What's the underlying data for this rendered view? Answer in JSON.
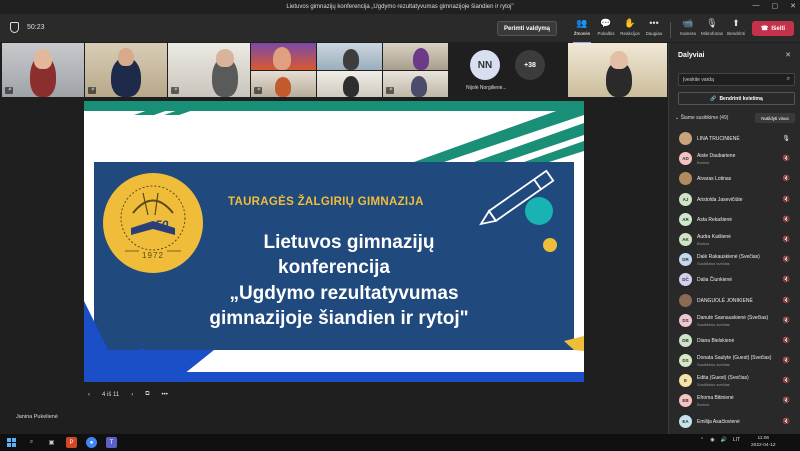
{
  "window": {
    "title": "Lietuvos gimnazijų konferencija „Ugdymo rezultatyvumas gimnazijoje šiandien ir rytoj\""
  },
  "toolbar": {
    "timer": "50:23",
    "take_control": "Perimti valdymą",
    "buttons": [
      {
        "label": "Žmonės",
        "icon": "people-icon"
      },
      {
        "label": "Pokalbis",
        "icon": "chat-icon"
      },
      {
        "label": "Reakcijos",
        "icon": "reactions-icon"
      },
      {
        "label": "Daugiau",
        "icon": "more-icon"
      },
      {
        "label": "Kamera",
        "icon": "camera-icon"
      },
      {
        "label": "Mikrofonas",
        "icon": "microphone-icon"
      },
      {
        "label": "Bendrinti",
        "icon": "share-icon"
      }
    ],
    "leave": "Išeiti"
  },
  "strip": {
    "avatar_initials": "NN",
    "avatar_name": "Nijolė Norgilienė...",
    "more_count": "+38"
  },
  "slide": {
    "school": "TAURAGĖS ŽALGIRIŲ GIMNAZIJA",
    "logo_year": "1972",
    "logo_number": "50",
    "line1": "Lietuvos gimnazijų",
    "line2": "konferencija",
    "line3": "„Ugdymo rezultatyvumas",
    "line4": "gimnazijoje šiandien ir rytoj\""
  },
  "slide_nav": {
    "page": "4 iš 11"
  },
  "presenter": "Janina Pukelienė",
  "panel": {
    "title": "Dalyviai",
    "search_placeholder": "Įveskite vardą",
    "share_invite": "Bendrinti kvietimą",
    "section": "Šiame susitikime (49)",
    "mute_all": "Nutildyti visus",
    "participants": [
      {
        "initials": "",
        "name": "LINA TRUCINIENĖ",
        "sub": "",
        "color": "#c9a37a",
        "photo": true,
        "mic": "on"
      },
      {
        "initials": "AD",
        "name": "Aiste Daubariene",
        "sub": "Borinis",
        "color": "#f4c3c3",
        "mic": "off"
      },
      {
        "initials": "",
        "name": "Aivaras Lotinas",
        "sub": "",
        "color": "#b08c60",
        "photo": true,
        "mic": "off"
      },
      {
        "initials": "AJ",
        "name": "Aristolda Jasevičiūte",
        "sub": "",
        "color": "#cfe3c6",
        "mic": "off"
      },
      {
        "initials": "AR",
        "name": "Asta Rekašienė",
        "sub": "",
        "color": "#cde8cf",
        "mic": "off"
      },
      {
        "initials": "AK",
        "name": "Audra Kaišienė",
        "sub": "Borinis",
        "color": "#cfe3c6",
        "mic": "off"
      },
      {
        "initials": "DR",
        "name": "Dalė Rakauskienė (Svečias)",
        "sub": "Susitikimo svečias",
        "color": "#c4d9ef",
        "mic": "off"
      },
      {
        "initials": "DČ",
        "name": "Dalia Čiunkienė",
        "sub": "",
        "color": "#d6d0f0",
        "mic": "off"
      },
      {
        "initials": "",
        "name": "DANGUOLĖ JONIKIENĖ",
        "sub": "",
        "color": "#8a6a55",
        "photo": true,
        "mic": "off"
      },
      {
        "initials": "DS",
        "name": "Danutė Sasnauskienė (Svečias)",
        "sub": "Susitikimo svečias",
        "color": "#f1c6d3",
        "mic": "off"
      },
      {
        "initials": "DB",
        "name": "Diana Bielskienė",
        "sub": "",
        "color": "#cfe3c6",
        "mic": "off"
      },
      {
        "initials": "DS",
        "name": "Donata Saulyte (Guest) (Svečias)",
        "sub": "Susitikimo svečias",
        "color": "#d7e8c4",
        "mic": "off"
      },
      {
        "initials": "E",
        "name": "Edita (Guest) (Svečias)",
        "sub": "Susitikimo svečias",
        "color": "#f6e3a8",
        "mic": "off"
      },
      {
        "initials": "EB",
        "name": "Efroma Bitinienė",
        "sub": "Borinis",
        "color": "#f4c3c3",
        "mic": "off"
      },
      {
        "initials": "EA",
        "name": "Emilija Asačiovienė",
        "sub": "",
        "color": "#c4e3ea",
        "mic": "off"
      }
    ]
  },
  "taskbar": {
    "tray_lang": "LIT",
    "time": "11:06",
    "date": "2022-04-12"
  },
  "colors": {
    "slide_navy": "#20497e",
    "slide_teal": "#1a8f78",
    "slide_yellow": "#f0bd3b",
    "leave_red": "#c4314b",
    "accent": "#9ea2ff"
  }
}
